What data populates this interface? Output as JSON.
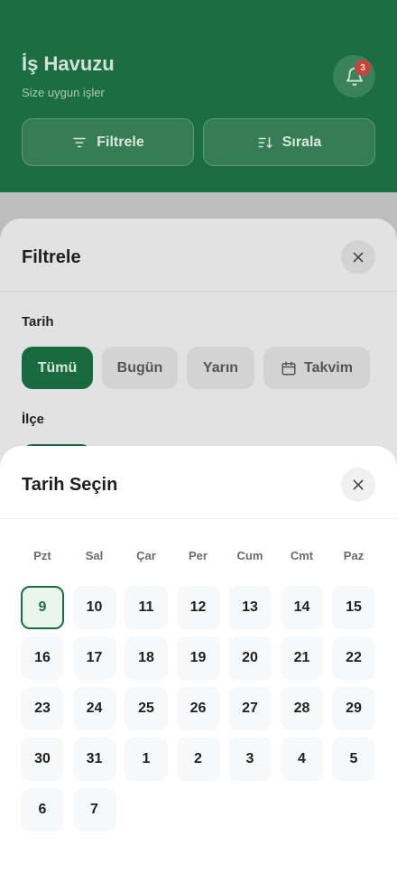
{
  "header": {
    "title": "İş Havuzu",
    "subtitle": "Size uygun işler",
    "notification_count": "3",
    "filter_label": "Filtrele",
    "sort_label": "Sırala"
  },
  "filter_sheet": {
    "title": "Filtrele",
    "date_label": "Tarih",
    "date_options": [
      "Tümü",
      "Bugün",
      "Yarın",
      "Takvim"
    ],
    "active_date_option": "Tümü",
    "district_label": "İlçe"
  },
  "date_picker": {
    "title": "Tarih Seçin",
    "weekdays": [
      "Pzt",
      "Sal",
      "Çar",
      "Per",
      "Cum",
      "Cmt",
      "Paz"
    ],
    "days": [
      "9",
      "10",
      "11",
      "12",
      "13",
      "14",
      "15",
      "16",
      "17",
      "18",
      "19",
      "20",
      "21",
      "22",
      "23",
      "24",
      "25",
      "26",
      "27",
      "28",
      "29",
      "30",
      "31",
      "1",
      "2",
      "3",
      "4",
      "5",
      "6",
      "7"
    ],
    "selected_day": "9"
  },
  "colors": {
    "primary": "#1b6e42",
    "badge": "#c5453e"
  }
}
